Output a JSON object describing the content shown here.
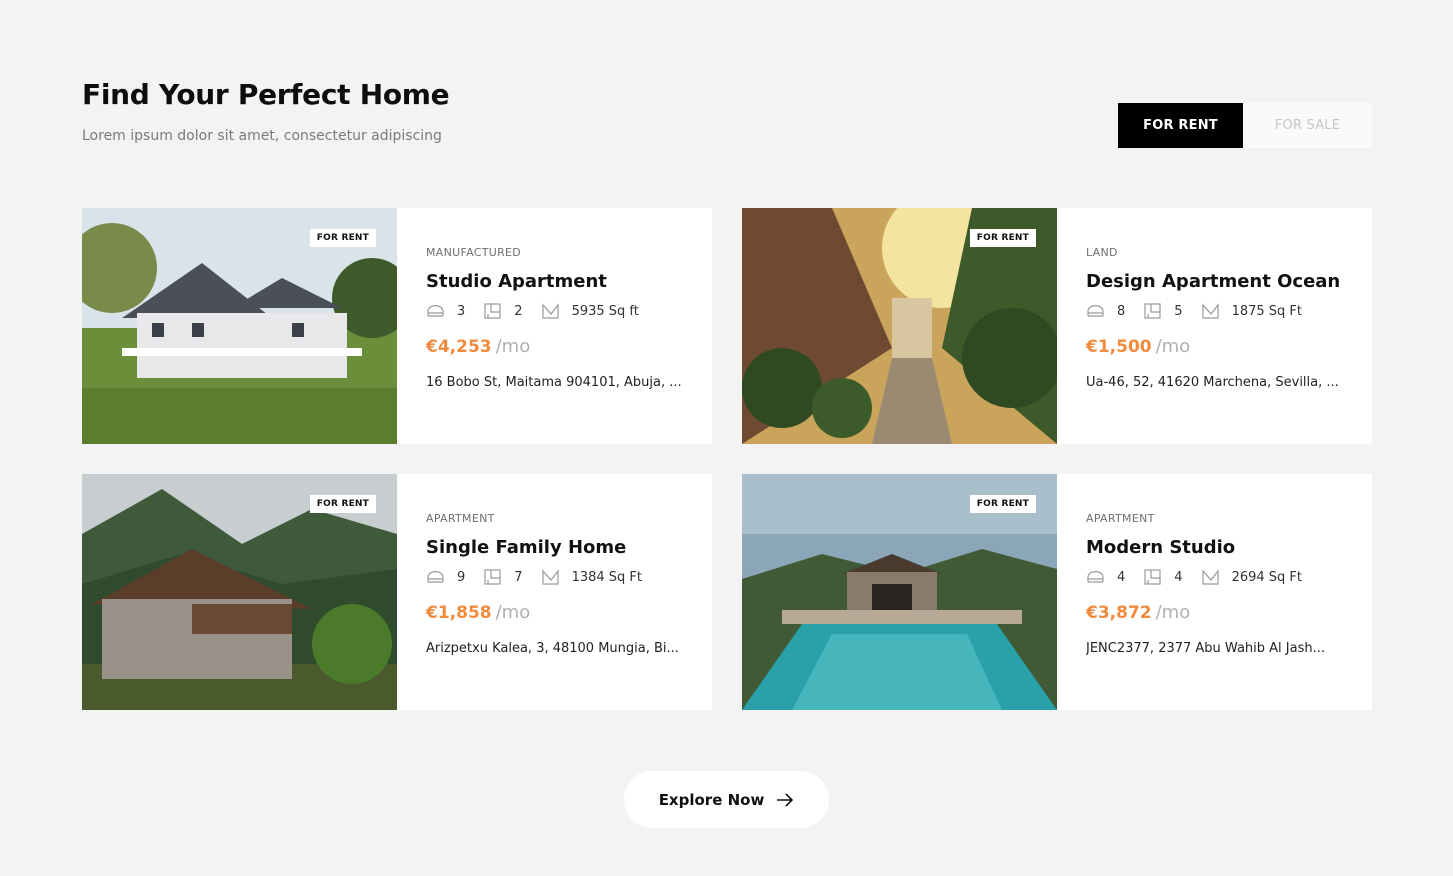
{
  "header": {
    "title": "Find Your Perfect Home",
    "subtitle": "Lorem ipsum dolor sit amet, consectetur adipiscing"
  },
  "toggle": {
    "rent_label": "FOR RENT",
    "sale_label": "FOR SALE"
  },
  "accent_color": "#f08a3c",
  "properties": [
    {
      "badge": "FOR RENT",
      "type": "MANUFACTURED",
      "name": "Studio Apartment",
      "beds": "3",
      "baths": "2",
      "area": "5935 Sq ft",
      "price": "€4,253",
      "period": "/mo",
      "address": "16 Bobo St, Maitama 904101, Abuja, ..."
    },
    {
      "badge": "FOR RENT",
      "type": "LAND",
      "name": "Design Apartment Ocean ...",
      "beds": "8",
      "baths": "5",
      "area": "1875 Sq Ft",
      "price": "€1,500",
      "period": "/mo",
      "address": "Ua-46, 52, 41620 Marchena, Sevilla, ..."
    },
    {
      "badge": "FOR RENT",
      "type": "APARTMENT",
      "name": "Single Family Home",
      "beds": "9",
      "baths": "7",
      "area": "1384 Sq Ft",
      "price": "€1,858",
      "period": "/mo",
      "address": "Arizpetxu Kalea, 3, 48100 Mungia, Bi..."
    },
    {
      "badge": "FOR RENT",
      "type": "APARTMENT",
      "name": "Modern Studio",
      "beds": "4",
      "baths": "4",
      "area": "2694 Sq Ft",
      "price": "€3,872",
      "period": "/mo",
      "address": "JENC2377, 2377 Abu Wahib Al Jash..."
    }
  ],
  "cta": {
    "label": "Explore Now"
  }
}
